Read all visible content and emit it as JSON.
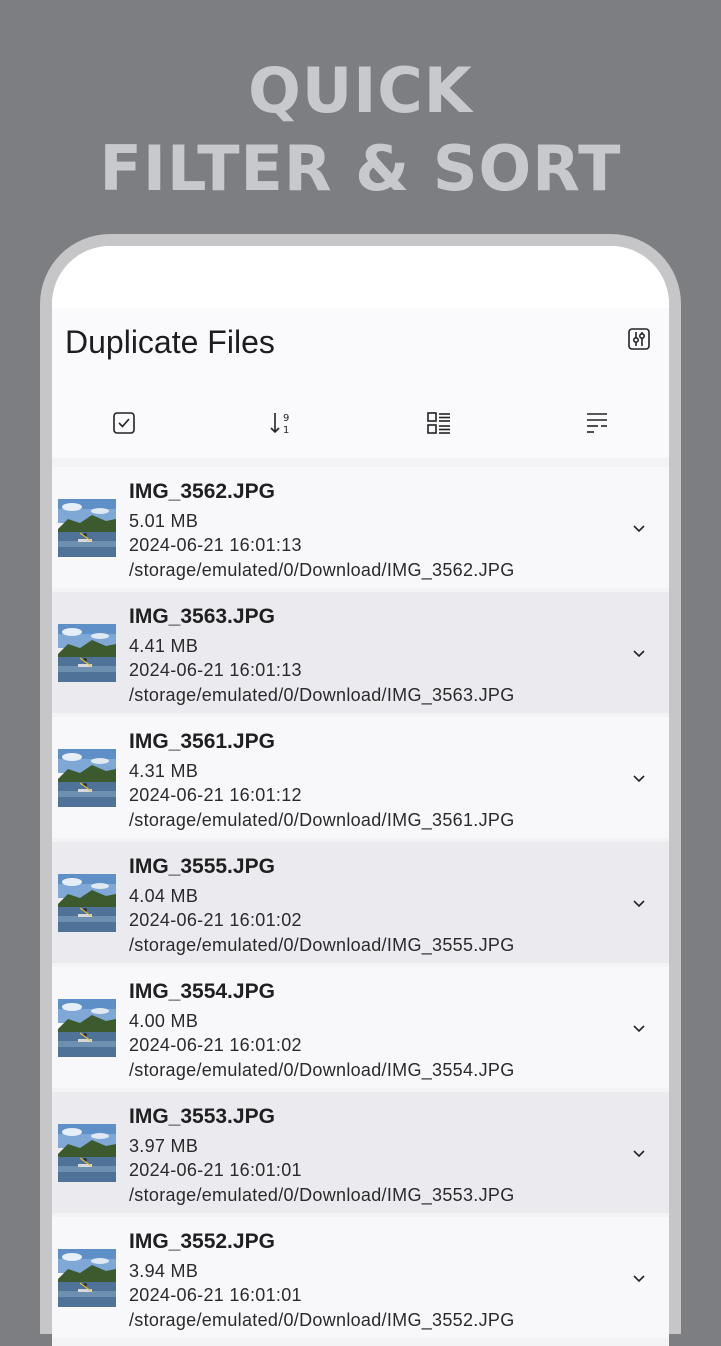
{
  "promo": {
    "line1": "QUICK",
    "line2": "FILTER & SORT"
  },
  "app": {
    "title": "Duplicate Files"
  },
  "icons": {
    "filter": "tune-icon",
    "select_all": "checkbox-icon",
    "sort": "sort-numeric-icon",
    "view": "list-view-icon",
    "group": "group-list-icon",
    "expand": "chevron-down-icon"
  },
  "files": [
    {
      "name": "IMG_3562.JPG",
      "size": "5.01 MB",
      "date": "2024-06-21 16:01:13",
      "path": "/storage/emulated/0/Download/IMG_3562.JPG"
    },
    {
      "name": "IMG_3563.JPG",
      "size": "4.41 MB",
      "date": "2024-06-21 16:01:13",
      "path": "/storage/emulated/0/Download/IMG_3563.JPG"
    },
    {
      "name": "IMG_3561.JPG",
      "size": "4.31 MB",
      "date": "2024-06-21 16:01:12",
      "path": "/storage/emulated/0/Download/IMG_3561.JPG"
    },
    {
      "name": "IMG_3555.JPG",
      "size": "4.04 MB",
      "date": "2024-06-21 16:01:02",
      "path": "/storage/emulated/0/Download/IMG_3555.JPG"
    },
    {
      "name": "IMG_3554.JPG",
      "size": "4.00 MB",
      "date": "2024-06-21 16:01:02",
      "path": "/storage/emulated/0/Download/IMG_3554.JPG"
    },
    {
      "name": "IMG_3553.JPG",
      "size": "3.97 MB",
      "date": "2024-06-21 16:01:01",
      "path": "/storage/emulated/0/Download/IMG_3553.JPG"
    },
    {
      "name": "IMG_3552.JPG",
      "size": "3.94 MB",
      "date": "2024-06-21 16:01:01",
      "path": "/storage/emulated/0/Download/IMG_3552.JPG"
    }
  ]
}
